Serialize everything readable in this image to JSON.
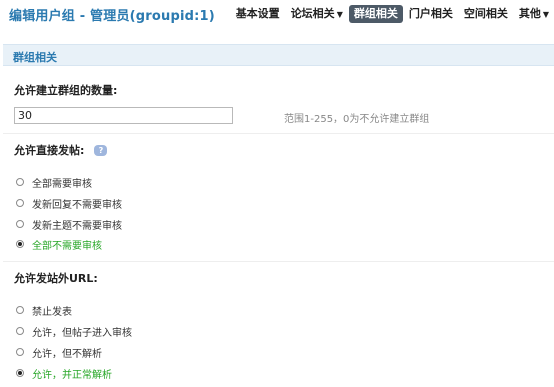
{
  "header": {
    "title": "编辑用户组 - 管理员(groupid:1)",
    "nav": [
      {
        "label": "基本设置",
        "active": false,
        "dropdown": false
      },
      {
        "label": "论坛相关",
        "active": false,
        "dropdown": true
      },
      {
        "label": "群组相关",
        "active": true,
        "dropdown": false
      },
      {
        "label": "门户相关",
        "active": false,
        "dropdown": false
      },
      {
        "label": "空间相关",
        "active": false,
        "dropdown": false
      },
      {
        "label": "其他",
        "active": false,
        "dropdown": true
      }
    ],
    "dropdown_caret": "▼"
  },
  "section": {
    "title": "群组相关"
  },
  "group_limit": {
    "label": "允许建立群组的数量:",
    "value": "30",
    "hint": "范围1-255，0为不允许建立群组"
  },
  "direct_post": {
    "label": "允许直接发帖:",
    "help_icon": "help-bubble-icon",
    "help_glyph": "?",
    "options": [
      {
        "label": "全部需要审核",
        "checked": false
      },
      {
        "label": "发新回复不需要审核",
        "checked": false
      },
      {
        "label": "发新主题不需要审核",
        "checked": false
      },
      {
        "label": "全部不需要审核",
        "checked": true
      }
    ]
  },
  "external_url": {
    "label": "允许发站外URL:",
    "options": [
      {
        "label": "禁止发表",
        "checked": false
      },
      {
        "label": "允许，但帖子进入审核",
        "checked": false
      },
      {
        "label": "允许，但不解析",
        "checked": false
      },
      {
        "label": "允许，并正常解析",
        "checked": true
      }
    ]
  },
  "colors": {
    "title_blue": "#2b7ab0",
    "active_tab_bg": "#4d5a67",
    "section_bg": "#e8f1f8",
    "selected_green": "#26a626"
  }
}
